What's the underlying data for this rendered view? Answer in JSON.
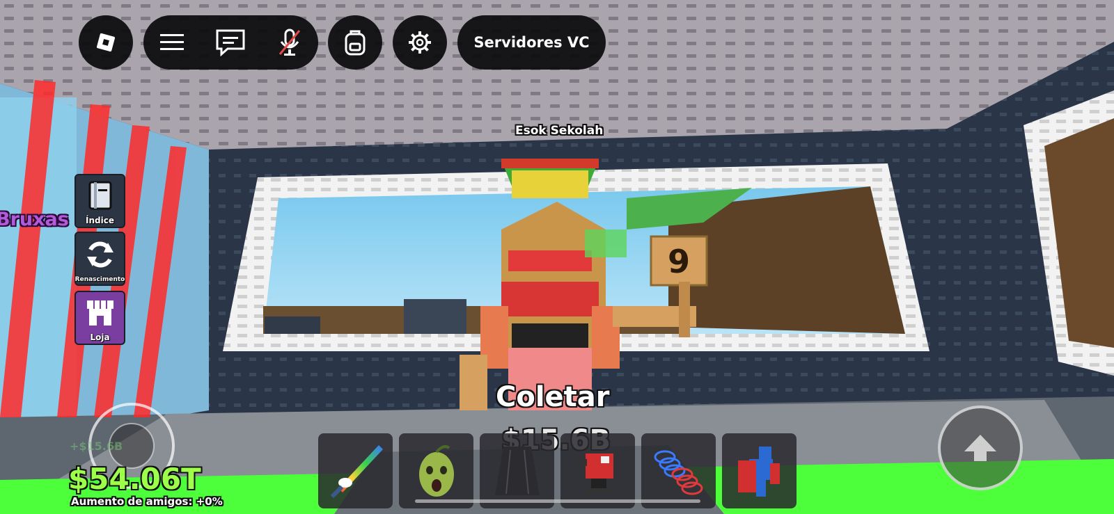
{
  "topbar": {
    "roblox_menu_icon": "roblox-logo-icon",
    "hamburger_icon": "hamburger-menu-icon",
    "chat_icon": "chat-icon",
    "mic_icon": "mic-muted-icon",
    "backpack_icon": "backpack-icon",
    "settings_icon": "gear-icon",
    "vc_servers_label": "Servidores VC"
  },
  "side_menu": {
    "index_label": "Índice",
    "rebirth_label": "Renascimento",
    "shop_label": "Loja"
  },
  "world": {
    "player_name": "Esok Sekolah",
    "sign_number": "9",
    "zone_label": "Bruxas",
    "collect_label": "Coletar",
    "collect_amount": "$15.6B"
  },
  "hud": {
    "money": "$54.06T",
    "money_faded": "+$15.6B",
    "friend_boost": "Aumento de amigos: +0%"
  },
  "hotbar": {
    "slots": [
      {
        "item": "rainbow-unicorn-sword-icon"
      },
      {
        "item": "zombie-mask-icon"
      },
      {
        "item": "dark-cape-icon"
      },
      {
        "item": "red-turret-icon"
      },
      {
        "item": "coil-springs-icon"
      },
      {
        "item": "red-blue-figure-icon"
      }
    ]
  },
  "colors": {
    "money_green": "#9dff4a",
    "panel_dark": "#0a0a0c",
    "laser_red": "#ff2a2a",
    "floor_green": "#4dff3a"
  }
}
